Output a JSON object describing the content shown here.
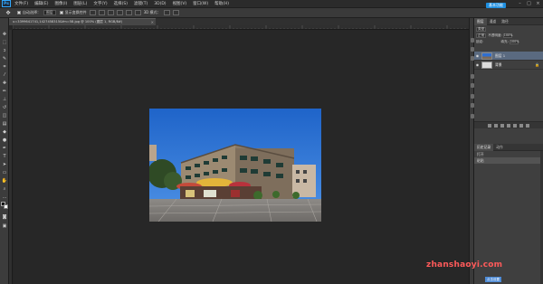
{
  "app": {
    "logo": "Ps"
  },
  "menubar": {
    "items": [
      "文件(F)",
      "编辑(E)",
      "图像(I)",
      "图层(L)",
      "文字(Y)",
      "选择(S)",
      "滤镜(T)",
      "3D(D)",
      "视图(V)",
      "窗口(W)",
      "帮助(H)"
    ],
    "window_controls": [
      "–",
      "□",
      "×"
    ],
    "badge": "基本功能"
  },
  "options": {
    "tool_icon": "move-tool-icon",
    "auto_select_label": "自动选择：",
    "auto_select_value": "图层",
    "show_transform_label": "显示变换控件",
    "mode_label": "3D 模式：",
    "align_label": "对齐"
  },
  "document": {
    "tab_title": "u=3399641741,1427458315&fm=58.jpg @ 100% (图层 1, RGB/8#)",
    "close_glyph": "×"
  },
  "layers_panel": {
    "tabs": [
      "图层",
      "通道",
      "路径"
    ],
    "kind_label": "类型",
    "blend_mode": "正常",
    "opacity_label": "不透明度:",
    "opacity_value": "100%",
    "lock_label": "锁定:",
    "fill_label": "填充:",
    "fill_value": "100%",
    "layers": [
      {
        "name": "图层 1",
        "visible": true,
        "selected": true
      },
      {
        "name": "背景",
        "visible": true,
        "selected": false,
        "locked": true
      }
    ],
    "lock_glyph": "🔒"
  },
  "history_panel": {
    "tabs": [
      "历史记录",
      "动作"
    ],
    "items": [
      "打开",
      "粘贴"
    ]
  },
  "watermark": "zhanshaoyi.com",
  "status_chip": "点击设置"
}
